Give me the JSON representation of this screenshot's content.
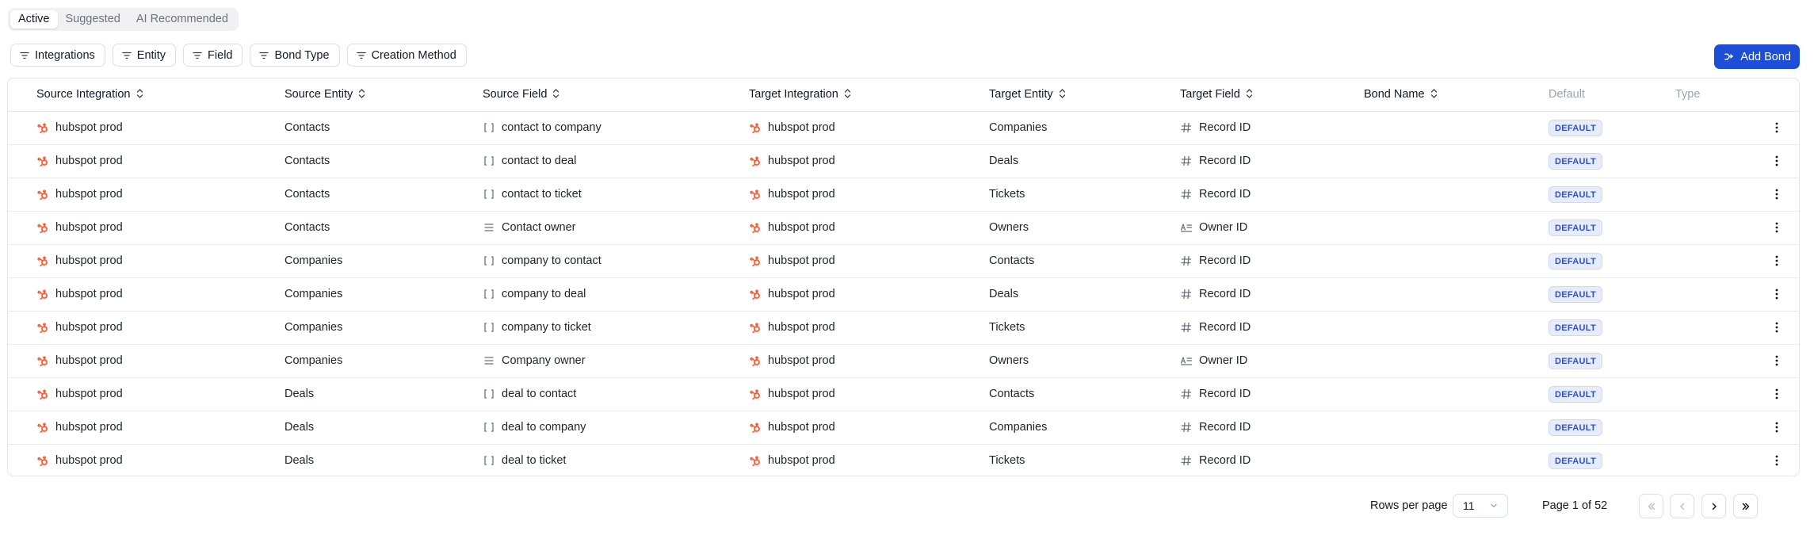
{
  "tabs": [
    {
      "label": "Active",
      "active": true
    },
    {
      "label": "Suggested",
      "active": false
    },
    {
      "label": "AI Recommended",
      "active": false
    }
  ],
  "filters": [
    "Integrations",
    "Entity",
    "Field",
    "Bond Type",
    "Creation Method"
  ],
  "add_button": {
    "label": "Add Bond"
  },
  "table": {
    "columns": [
      "Source Integration",
      "Source Entity",
      "Source Field",
      "Target Integration",
      "Target Entity",
      "Target Field",
      "Bond Name",
      "Default",
      "Type"
    ],
    "rows": [
      {
        "source_integration": "hubspot prod",
        "source_entity": "Contacts",
        "source_field": "contact to company",
        "source_field_icon": "brackets-icon",
        "target_integration": "hubspot prod",
        "target_entity": "Companies",
        "target_field": "Record ID",
        "target_field_icon": "hash-icon",
        "bond_name": "",
        "default": "DEFAULT",
        "type": ""
      },
      {
        "source_integration": "hubspot prod",
        "source_entity": "Contacts",
        "source_field": "contact to deal",
        "source_field_icon": "brackets-icon",
        "target_integration": "hubspot prod",
        "target_entity": "Deals",
        "target_field": "Record ID",
        "target_field_icon": "hash-icon",
        "bond_name": "",
        "default": "DEFAULT",
        "type": ""
      },
      {
        "source_integration": "hubspot prod",
        "source_entity": "Contacts",
        "source_field": "contact to ticket",
        "source_field_icon": "brackets-icon",
        "target_integration": "hubspot prod",
        "target_entity": "Tickets",
        "target_field": "Record ID",
        "target_field_icon": "hash-icon",
        "bond_name": "",
        "default": "DEFAULT",
        "type": ""
      },
      {
        "source_integration": "hubspot prod",
        "source_entity": "Contacts",
        "source_field": "Contact owner",
        "source_field_icon": "list-icon",
        "target_integration": "hubspot prod",
        "target_entity": "Owners",
        "target_field": "Owner ID",
        "target_field_icon": "text-field-icon",
        "bond_name": "",
        "default": "DEFAULT",
        "type": ""
      },
      {
        "source_integration": "hubspot prod",
        "source_entity": "Companies",
        "source_field": "company to contact",
        "source_field_icon": "brackets-icon",
        "target_integration": "hubspot prod",
        "target_entity": "Contacts",
        "target_field": "Record ID",
        "target_field_icon": "hash-icon",
        "bond_name": "",
        "default": "DEFAULT",
        "type": ""
      },
      {
        "source_integration": "hubspot prod",
        "source_entity": "Companies",
        "source_field": "company to deal",
        "source_field_icon": "brackets-icon",
        "target_integration": "hubspot prod",
        "target_entity": "Deals",
        "target_field": "Record ID",
        "target_field_icon": "hash-icon",
        "bond_name": "",
        "default": "DEFAULT",
        "type": ""
      },
      {
        "source_integration": "hubspot prod",
        "source_entity": "Companies",
        "source_field": "company to ticket",
        "source_field_icon": "brackets-icon",
        "target_integration": "hubspot prod",
        "target_entity": "Tickets",
        "target_field": "Record ID",
        "target_field_icon": "hash-icon",
        "bond_name": "",
        "default": "DEFAULT",
        "type": ""
      },
      {
        "source_integration": "hubspot prod",
        "source_entity": "Companies",
        "source_field": "Company owner",
        "source_field_icon": "list-icon",
        "target_integration": "hubspot prod",
        "target_entity": "Owners",
        "target_field": "Owner ID",
        "target_field_icon": "text-field-icon",
        "bond_name": "",
        "default": "DEFAULT",
        "type": ""
      },
      {
        "source_integration": "hubspot prod",
        "source_entity": "Deals",
        "source_field": "deal to contact",
        "source_field_icon": "brackets-icon",
        "target_integration": "hubspot prod",
        "target_entity": "Contacts",
        "target_field": "Record ID",
        "target_field_icon": "hash-icon",
        "bond_name": "",
        "default": "DEFAULT",
        "type": ""
      },
      {
        "source_integration": "hubspot prod",
        "source_entity": "Deals",
        "source_field": "deal to company",
        "source_field_icon": "brackets-icon",
        "target_integration": "hubspot prod",
        "target_entity": "Companies",
        "target_field": "Record ID",
        "target_field_icon": "hash-icon",
        "bond_name": "",
        "default": "DEFAULT",
        "type": ""
      },
      {
        "source_integration": "hubspot prod",
        "source_entity": "Deals",
        "source_field": "deal to ticket",
        "source_field_icon": "brackets-icon",
        "target_integration": "hubspot prod",
        "target_entity": "Tickets",
        "target_field": "Record ID",
        "target_field_icon": "hash-icon",
        "bond_name": "",
        "default": "DEFAULT",
        "type": ""
      }
    ]
  },
  "pagination": {
    "rows_per_page_label": "Rows per page",
    "rows_per_page_value": "11",
    "page_label": "Page 1 of 52"
  },
  "colors": {
    "accent": "#1d4ed8",
    "hubspot": "#ff5c35",
    "badge_text": "#2f50c7",
    "badge_bg": "#e7ecfb"
  }
}
